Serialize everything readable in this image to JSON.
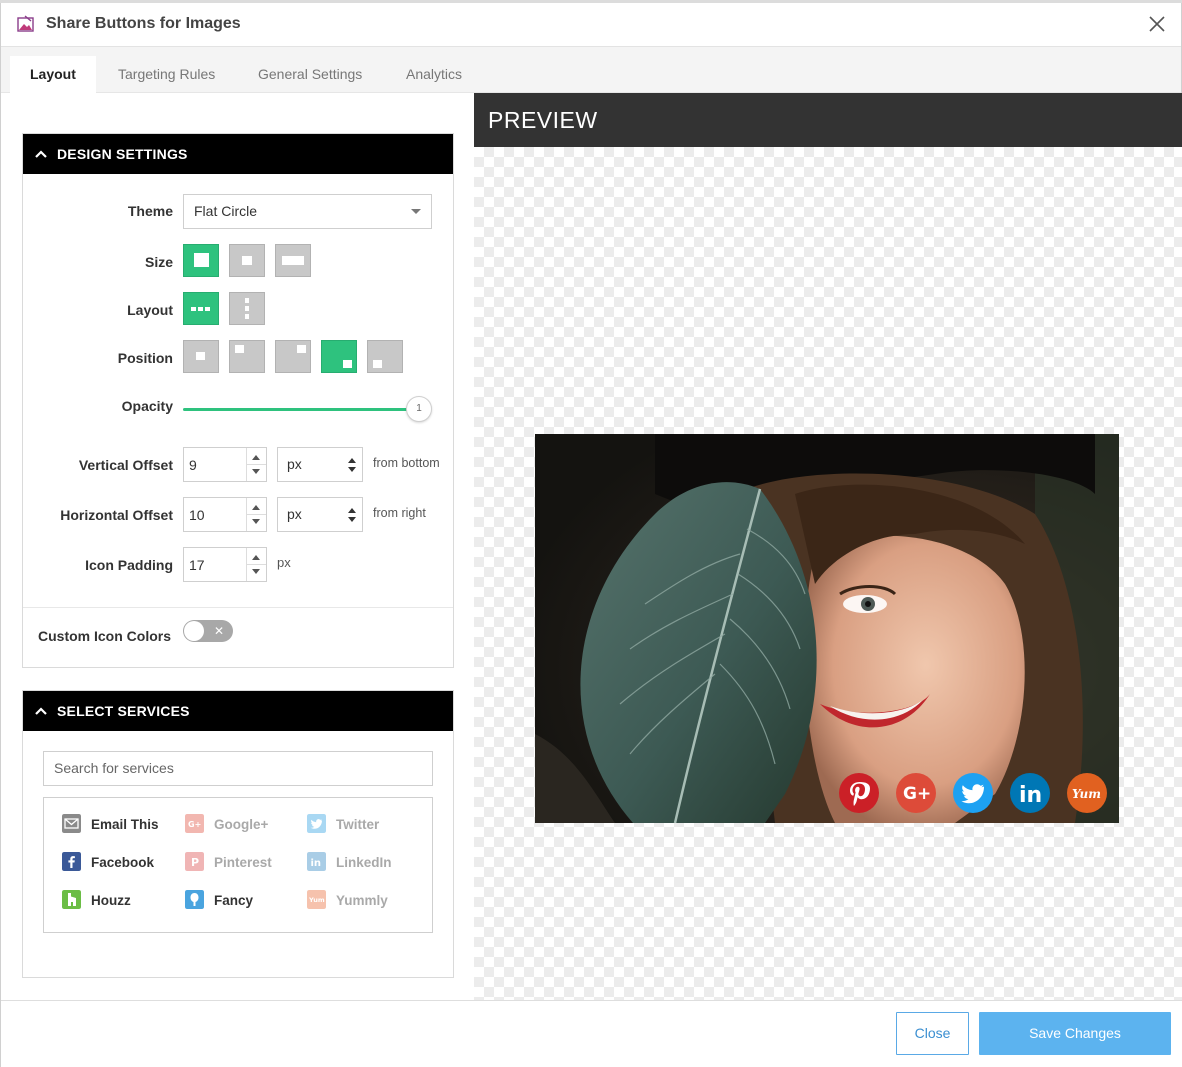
{
  "window": {
    "title": "Share Buttons for Images"
  },
  "tabs": [
    {
      "label": "Layout",
      "active": true
    },
    {
      "label": "Targeting Rules",
      "active": false
    },
    {
      "label": "General Settings",
      "active": false
    },
    {
      "label": "Analytics",
      "active": false
    }
  ],
  "design": {
    "header": "DESIGN SETTINGS",
    "theme_label": "Theme",
    "theme_value": "Flat Circle",
    "size_label": "Size",
    "layout_label": "Layout",
    "position_label": "Position",
    "opacity_label": "Opacity",
    "opacity_value": "1",
    "vertical_offset_label": "Vertical Offset",
    "vertical_offset_value": "9",
    "vertical_offset_unit": "px",
    "vertical_offset_hint": "from bottom",
    "horizontal_offset_label": "Horizontal Offset",
    "horizontal_offset_value": "10",
    "horizontal_offset_unit": "px",
    "horizontal_offset_hint": "from right",
    "icon_padding_label": "Icon Padding",
    "icon_padding_value": "17",
    "icon_padding_unit": "px",
    "custom_colors_label": "Custom Icon Colors"
  },
  "services": {
    "header": "SELECT SERVICES",
    "search_placeholder": "Search for services",
    "items": [
      {
        "label": "Email This",
        "selected": true,
        "icon": "email-icon",
        "color": "#8a8a8a"
      },
      {
        "label": "Google+",
        "selected": false,
        "icon": "google-plus-icon",
        "color": "#f2b7b0"
      },
      {
        "label": "Twitter",
        "selected": false,
        "icon": "twitter-icon",
        "color": "#a9d8f3"
      },
      {
        "label": "Facebook",
        "selected": true,
        "icon": "facebook-icon",
        "color": "#3b5998"
      },
      {
        "label": "Pinterest",
        "selected": false,
        "icon": "pinterest-icon",
        "color": "#f0b5b5"
      },
      {
        "label": "LinkedIn",
        "selected": false,
        "icon": "linkedin-icon",
        "color": "#a9cde6"
      },
      {
        "label": "Houzz",
        "selected": true,
        "icon": "houzz-icon",
        "color": "#6bbd45"
      },
      {
        "label": "Fancy",
        "selected": true,
        "icon": "fancy-icon",
        "color": "#4aa4df"
      },
      {
        "label": "Yummly",
        "selected": false,
        "icon": "yummly-icon",
        "color": "#f6c2ad"
      }
    ]
  },
  "preview": {
    "header": "PREVIEW",
    "share_buttons": [
      {
        "name": "pinterest",
        "glyph": "P",
        "color": "#cb2027"
      },
      {
        "name": "google-plus",
        "glyph": "G+",
        "color": "#dd4b39"
      },
      {
        "name": "twitter",
        "glyph": "t",
        "color": "#1da1f2"
      },
      {
        "name": "linkedin",
        "glyph": "in",
        "color": "#0077b5"
      },
      {
        "name": "yummly",
        "glyph": "Yum",
        "color": "#e16120"
      }
    ]
  },
  "footer": {
    "close_label": "Close",
    "save_label": "Save Changes"
  }
}
